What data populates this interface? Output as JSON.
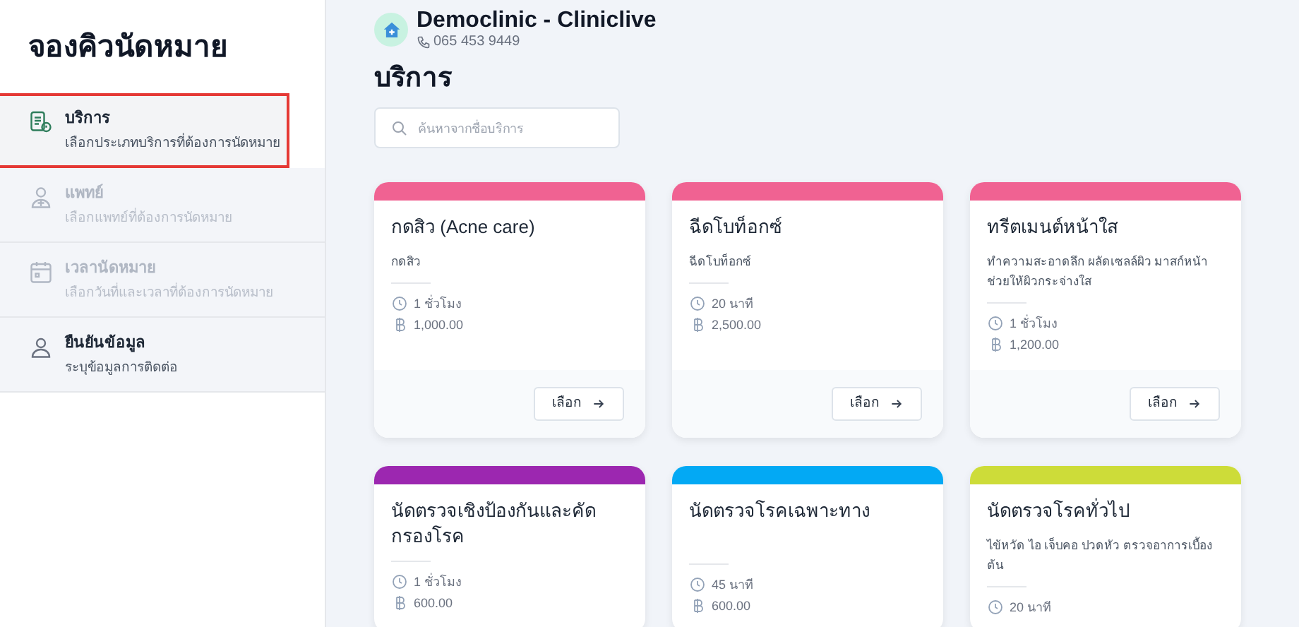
{
  "sidebar": {
    "title": "จองคิวนัดหมาย",
    "steps": [
      {
        "kind": "service",
        "title": "บริการ",
        "subtitle": "เลือกประเภทบริการที่ต้องการนัดหมาย",
        "selected": true,
        "disabled": false
      },
      {
        "kind": "doctor",
        "title": "แพทย์",
        "subtitle": "เลือกแพทย์ที่ต้องการนัดหมาย",
        "selected": false,
        "disabled": true
      },
      {
        "kind": "calendar",
        "title": "เวลานัดหมาย",
        "subtitle": "เลือกวันที่และเวลาที่ต้องการนัดหมาย",
        "selected": false,
        "disabled": true
      },
      {
        "kind": "person",
        "title": "ยืนยันข้อมูล",
        "subtitle": "ระบุข้อมูลการติดต่อ",
        "selected": false,
        "disabled": false
      }
    ]
  },
  "clinic": {
    "name": "Democlinic - Cliniclive",
    "phone": "065 453 9449"
  },
  "page_title": "บริการ",
  "search": {
    "placeholder": "ค้นหาจากชื่อบริการ"
  },
  "services": [
    {
      "title": "กดสิว (Acne care)",
      "description": "กดสิว",
      "duration": "1 ชั่วโมง",
      "price": "1,000.00",
      "button": "เลือก",
      "color": "#f06292"
    },
    {
      "title": "ฉีดโบท็อกซ์",
      "description": "ฉีดโบท็อกซ์",
      "duration": "20 นาที",
      "price": "2,500.00",
      "button": "เลือก",
      "color": "#f06292"
    },
    {
      "title": "ทรีตเมนต์หน้าใส",
      "description": "ทำความสะอาดลึก ผลัดเซลล์ผิว มาสก์หน้า ช่วยให้ผิวกระจ่างใส",
      "duration": "1 ชั่วโมง",
      "price": "1,200.00",
      "button": "เลือก",
      "color": "#f06292"
    },
    {
      "title": "นัดตรวจเชิงป้องกันและคัดกรองโรค",
      "duration": "1 ชั่วโมง",
      "price": "600.00",
      "color": "#9c27b0"
    },
    {
      "title": "นัดตรวจโรคเฉพาะทาง",
      "duration": "45 นาที",
      "price": "600.00",
      "color": "#03a9f4"
    },
    {
      "title": "นัดตรวจโรคทั่วไป",
      "description": "ไข้หวัด ไอ เจ็บคอ ปวดหัว ตรวจอาการเบื้องต้น",
      "duration": "20 นาที",
      "color": "#cddc39"
    }
  ]
}
